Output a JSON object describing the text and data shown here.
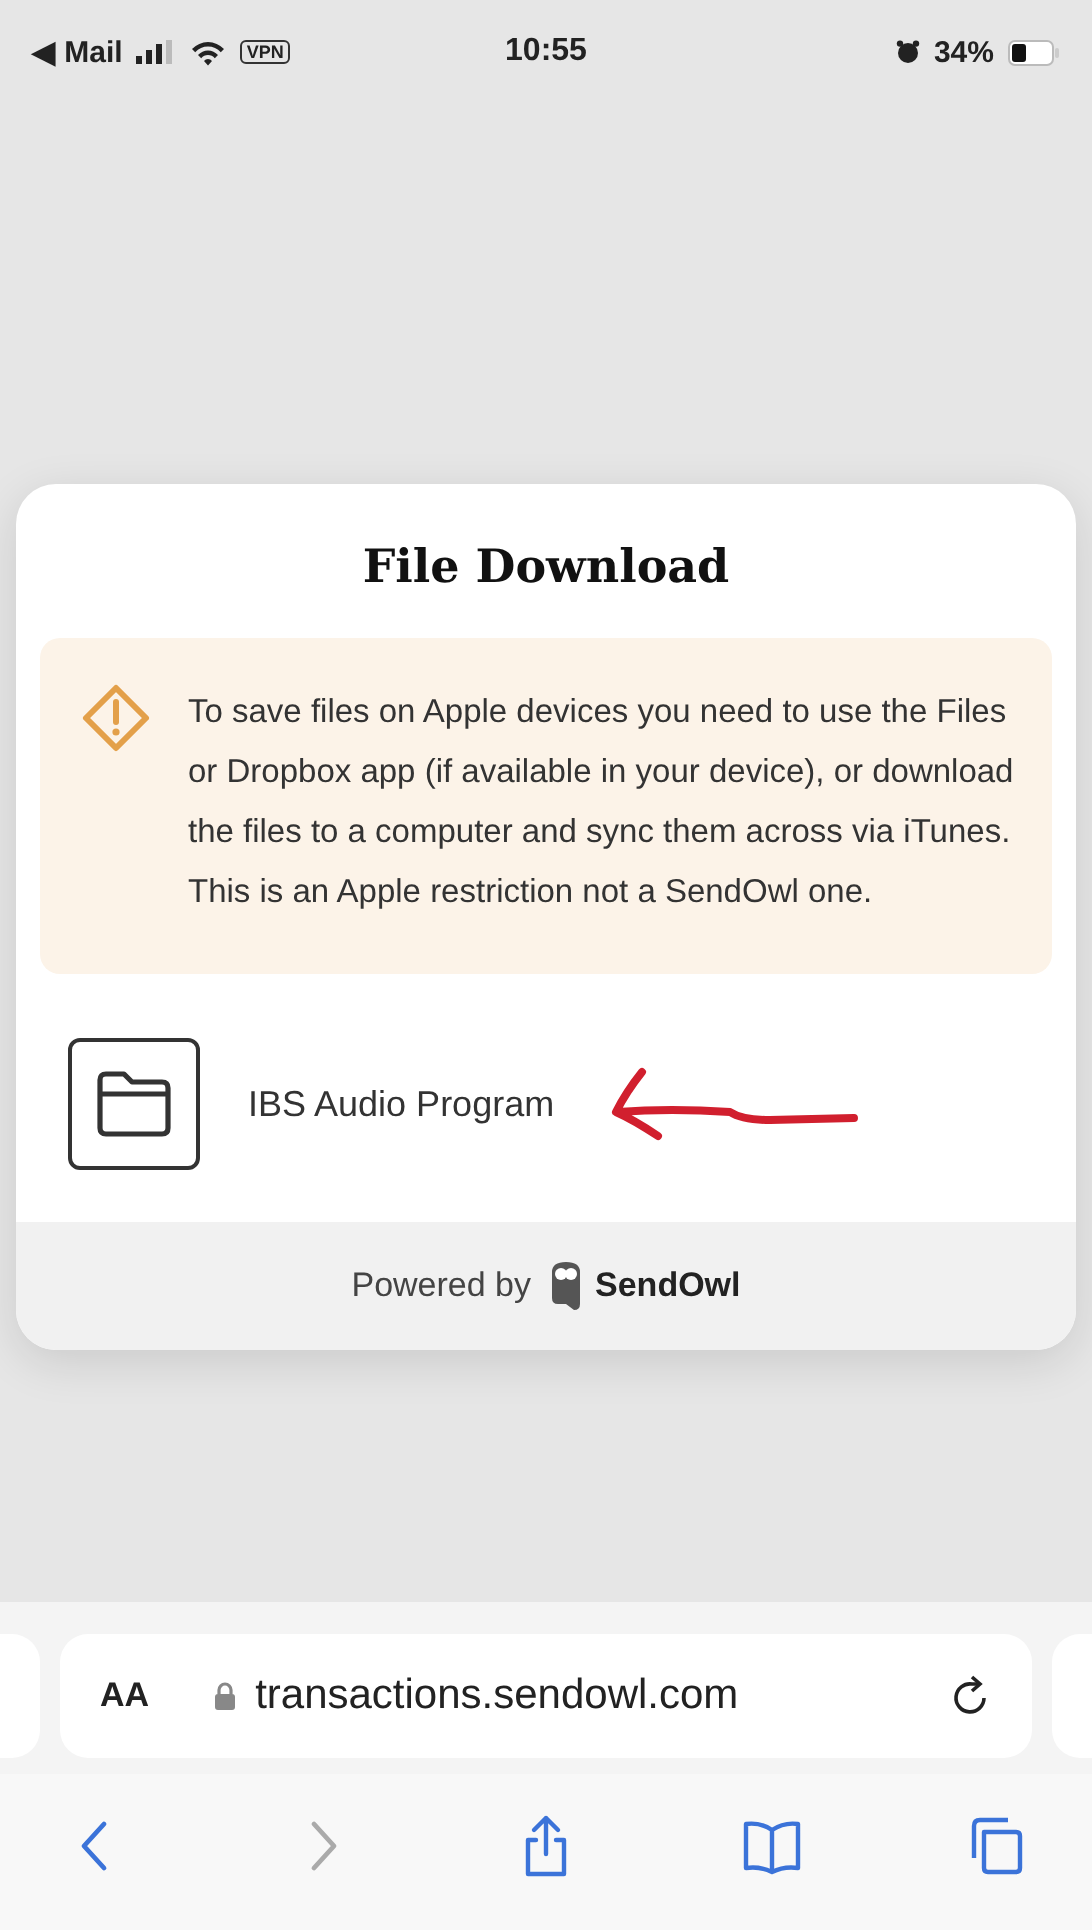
{
  "status_bar": {
    "back_app": "◀ Mail",
    "vpn": "VPN",
    "time": "10:55",
    "battery": "34%"
  },
  "dialog": {
    "title": "File Download",
    "notice": "To save files on Apple devices you need to use the Files or Dropbox app (if available in your device), or download the files to a computer and sync them across via iTunes. This is an Apple restriction not a SendOwl one.",
    "files": [
      {
        "name": "IBS Audio Program"
      }
    ],
    "footer": {
      "prefix": "Powered by",
      "brand": "SendOwl"
    }
  },
  "address_bar": {
    "text_size": "AA",
    "url": "transactions.sendowl.com"
  },
  "toolbar": [
    {
      "kind": "back",
      "disabled": false
    },
    {
      "kind": "forward",
      "disabled": true
    },
    {
      "kind": "share",
      "disabled": false
    },
    {
      "kind": "bookmarks",
      "disabled": false
    },
    {
      "kind": "tabs",
      "disabled": false
    }
  ]
}
